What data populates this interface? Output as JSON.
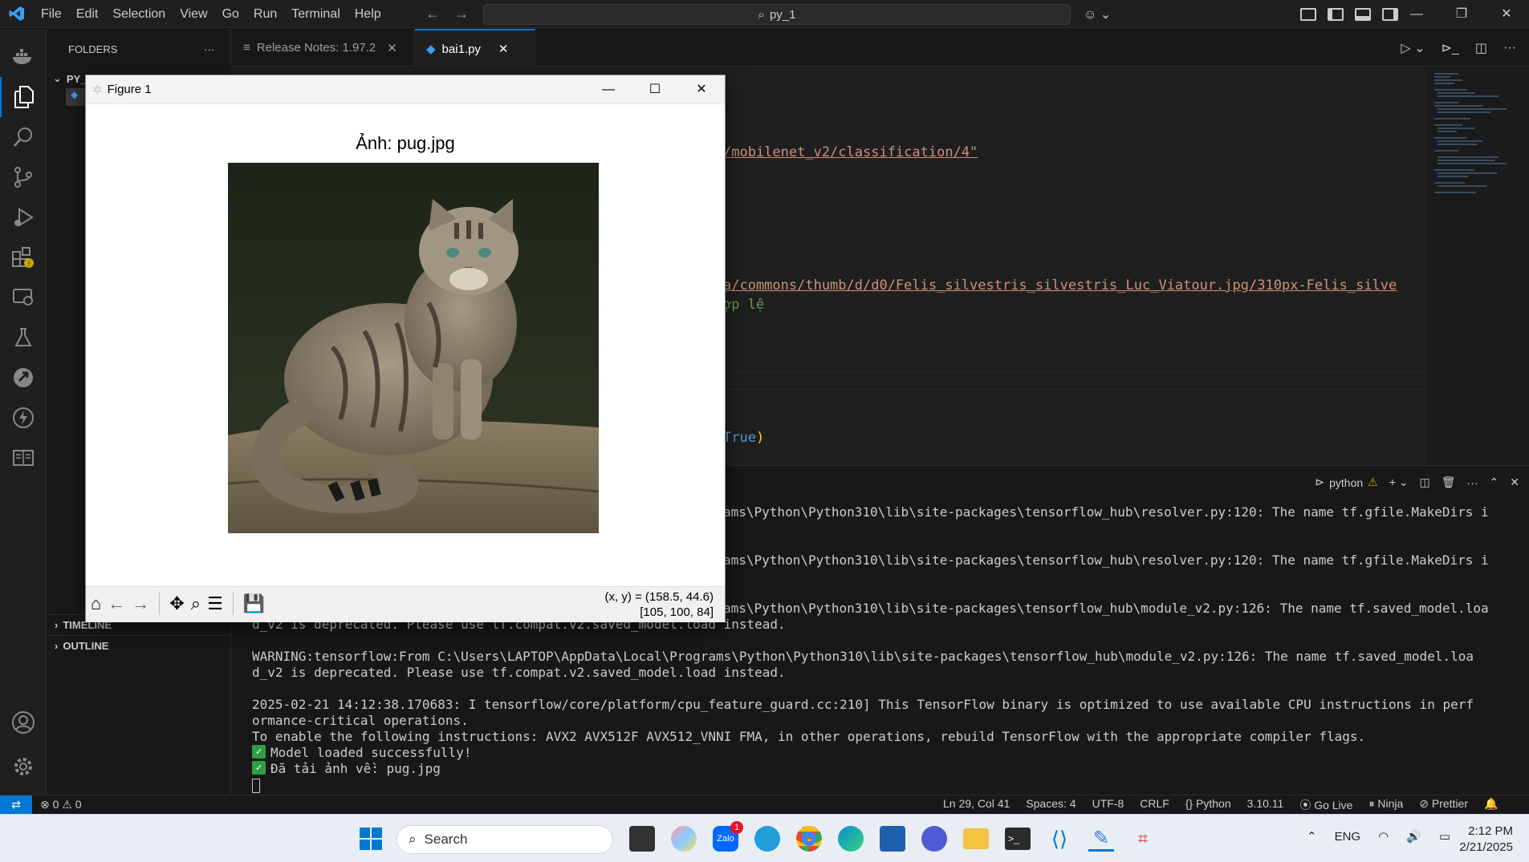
{
  "menubar": {
    "items": [
      "File",
      "Edit",
      "Selection",
      "View",
      "Go",
      "Run",
      "Terminal",
      "Help"
    ]
  },
  "command_center": {
    "text": "py_1"
  },
  "sidebar": {
    "title": "FOLDERS",
    "folder": "PY_1",
    "sections": [
      "TIMELINE",
      "OUTLINE"
    ]
  },
  "tabs": [
    {
      "label": "Release Notes: 1.97.2",
      "active": false
    },
    {
      "label": "bai1.py",
      "active": true
    }
  ],
  "editor": {
    "line1": "/mobilenet_v2/classification/4\"",
    "line2": "a/commons/thumb/d/d0/Felis_silvestris_silvestris_Luc_Viatour.jpg/310px-Felis_silve",
    "line3": "ợp lệ",
    "line4_kw": "True",
    "line4_rest": ")"
  },
  "panel": {
    "shell_label": "python"
  },
  "terminal": {
    "lines": [
      "ams\\Python\\Python310\\lib\\site-packages\\tensorflow_hub\\resolver.py:120: The name tf.gfile.MakeDirs i",
      "ams\\Python\\Python310\\lib\\site-packages\\tensorflow_hub\\resolver.py:120: The name tf.gfile.MakeDirs i",
      "ams\\Python\\Python310\\lib\\site-packages\\tensorflow_hub\\module_v2.py:126: The name tf.saved_model.loa",
      "d_v2 is deprecated. Please use tf.compat.v2.saved_model.load instead.",
      "WARNING:tensorflow:From C:\\Users\\LAPTOP\\AppData\\Local\\Programs\\Python\\Python310\\lib\\site-packages\\tensorflow_hub\\module_v2.py:126: The name tf.saved_model.loa",
      "d_v2 is deprecated. Please use tf.compat.v2.saved_model.load instead.",
      "2025-02-21 14:12:38.170683: I tensorflow/core/platform/cpu_feature_guard.cc:210] This TensorFlow binary is optimized to use available CPU instructions in perf",
      "ormance-critical operations.",
      "To enable the following instructions: AVX2 AVX512F AVX512_VNNI FMA, in other operations, rebuild TensorFlow with the appropriate compiler flags.",
      "Model loaded successfully!",
      "Đã tải ảnh về: pug.jpg"
    ]
  },
  "figure": {
    "window_title": "Figure 1",
    "plot_title": "Ảnh: pug.jpg",
    "coords": "(x, y) = (158.5, 44.6)",
    "pixel": "[105, 100, 84]"
  },
  "statusbar": {
    "errors": "0",
    "warnings": "0",
    "position": "Ln 29, Col 41",
    "spaces": "Spaces: 4",
    "encoding": "UTF-8",
    "eol": "CRLF",
    "language": "Python",
    "version": "3.10.11",
    "golive": "Go Live",
    "ninja": "Ninja",
    "prettier": "Prettier"
  },
  "taskbar": {
    "search_placeholder": "Search",
    "zalo_badge": "1",
    "lang": "ENG",
    "time": "2:12 PM",
    "date": "2/21/2025"
  },
  "colors": {
    "accent": "#0078d4",
    "string": "#ce9178",
    "keyword": "#569cd6",
    "comment": "#6a9955",
    "warning": "#cca700"
  }
}
